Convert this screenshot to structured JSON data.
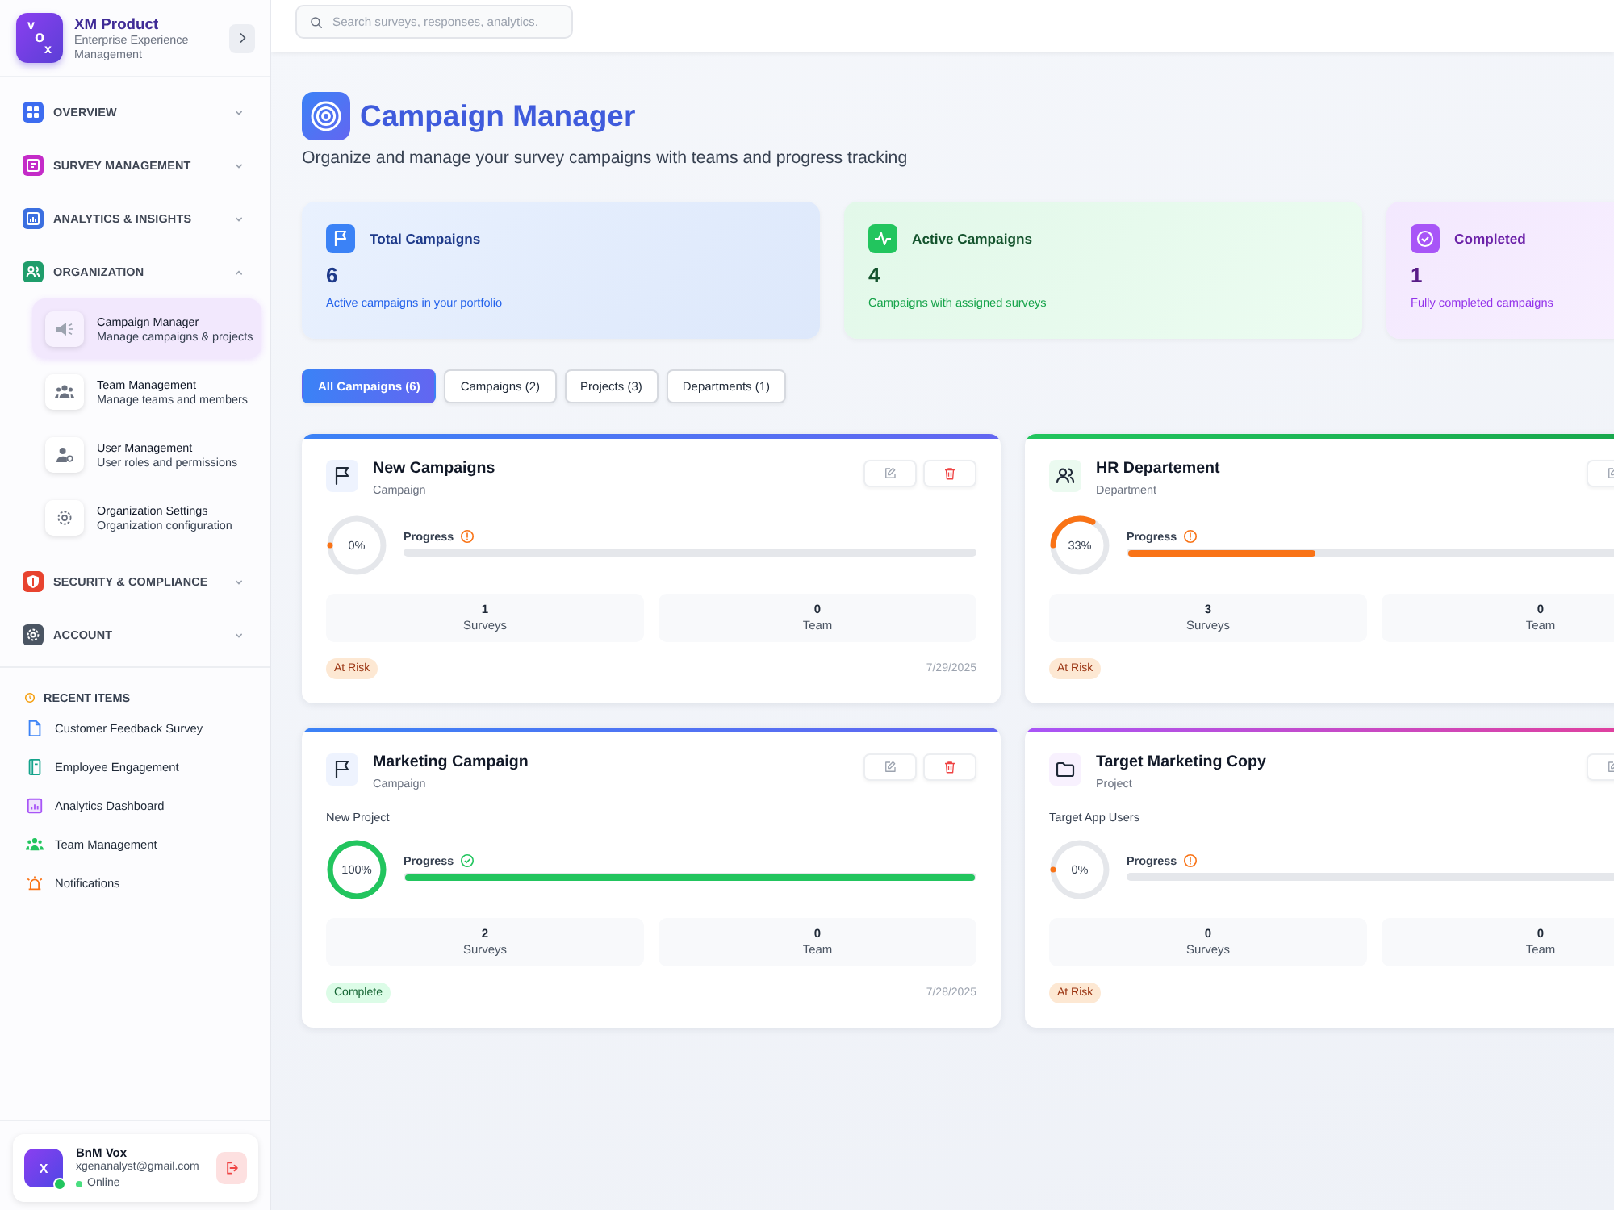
{
  "sidebar": {
    "brand": {
      "logo_letters": [
        "v",
        "o",
        "x"
      ],
      "title": "XM Product",
      "subtitle": "Enterprise Experience Management"
    },
    "nav": [
      {
        "kind": "overview",
        "label": "OVERVIEW",
        "expanded": false
      },
      {
        "kind": "surveys",
        "label": "SURVEY MANAGEMENT",
        "expanded": false
      },
      {
        "kind": "analytics",
        "label": "ANALYTICS & INSIGHTS",
        "expanded": false
      },
      {
        "kind": "organization",
        "label": "ORGANIZATION",
        "expanded": true,
        "children": [
          {
            "kind": "campaigns",
            "title": "Campaign Manager",
            "subtitle": "Manage campaigns & projects",
            "selected": true
          },
          {
            "kind": "teams",
            "title": "Team Management",
            "subtitle": "Manage teams and members",
            "selected": false
          },
          {
            "kind": "users",
            "title": "User Management",
            "subtitle": "User roles and permissions",
            "selected": false
          },
          {
            "kind": "settings",
            "title": "Organization Settings",
            "subtitle": "Organization configuration",
            "selected": false
          }
        ]
      },
      {
        "kind": "security",
        "label": "SECURITY & COMPLIANCE",
        "expanded": false
      },
      {
        "kind": "account",
        "label": "ACCOUNT",
        "expanded": false
      }
    ],
    "recent": {
      "title": "RECENT ITEMS",
      "items": [
        {
          "kind": "survey",
          "label": "Customer Feedback Survey"
        },
        {
          "kind": "engagement",
          "label": "Employee Engagement"
        },
        {
          "kind": "dashboard",
          "label": "Analytics Dashboard"
        },
        {
          "kind": "team",
          "label": "Team Management"
        },
        {
          "kind": "notifications",
          "label": "Notifications"
        }
      ]
    },
    "user": {
      "avatar_letter": "X",
      "name": "BnM Vox",
      "email": "xgenanalyst@gmail.com",
      "status": "Online",
      "online": true
    }
  },
  "header": {
    "search": {
      "placeholder": "Search surveys, responses, analytics."
    }
  },
  "page": {
    "title": "Campaign Manager",
    "subtitle": "Organize and manage your survey campaigns with teams and progress tracking"
  },
  "stats": [
    {
      "kind": "total",
      "label": "Total Campaigns",
      "value": "6",
      "description": "Active campaigns in your portfolio"
    },
    {
      "kind": "active",
      "label": "Active Campaigns",
      "value": "4",
      "description": "Campaigns with assigned surveys"
    },
    {
      "kind": "completed",
      "label": "Completed",
      "value": "1",
      "description": "Fully completed campaigns"
    }
  ],
  "filters": [
    {
      "label": "All Campaigns (6)",
      "selected": true
    },
    {
      "label": "Campaigns (2)",
      "selected": false
    },
    {
      "label": "Projects (3)",
      "selected": false
    },
    {
      "label": "Departments (1)",
      "selected": false
    }
  ],
  "cards": [
    {
      "kind": "campaign",
      "title": "New Campaigns",
      "type": "Campaign",
      "actions": [
        {
          "kind": "edit"
        },
        {
          "kind": "delete"
        }
      ],
      "progress": {
        "label": "Progress",
        "reading": "0%",
        "level": 0
      },
      "stats": [
        {
          "value": "1",
          "label": "Surveys"
        },
        {
          "value": "0",
          "label": "Team"
        }
      ],
      "status": {
        "kind": "at_risk",
        "label": "At Risk"
      },
      "date": "7/29/2025"
    },
    {
      "kind": "department",
      "title": "HR Departement",
      "type": "Department",
      "actions": [
        {
          "kind": "edit"
        }
      ],
      "progress": {
        "label": "Progress",
        "reading": "33%",
        "level": 0.33
      },
      "stats": [
        {
          "value": "3",
          "label": "Surveys"
        },
        {
          "value": "0",
          "label": "Team"
        }
      ],
      "status": {
        "kind": "at_risk",
        "label": "At Risk"
      }
    },
    {
      "kind": "campaign",
      "title": "Marketing Campaign",
      "type": "Campaign",
      "actions": [
        {
          "kind": "edit"
        },
        {
          "kind": "delete"
        }
      ],
      "description": "New Project",
      "progress": {
        "label": "Progress",
        "reading": "100%",
        "level": 1
      },
      "stats": [
        {
          "value": "2",
          "label": "Surveys"
        },
        {
          "value": "0",
          "label": "Team"
        }
      ],
      "status": {
        "kind": "complete",
        "label": "Complete"
      },
      "date": "7/28/2025"
    },
    {
      "kind": "project",
      "title": "Target Marketing Copy",
      "type": "Project",
      "actions": [
        {
          "kind": "edit"
        }
      ],
      "description": "Target App Users",
      "progress": {
        "label": "Progress",
        "reading": "0%",
        "level": 0
      },
      "stats": [
        {
          "value": "0",
          "label": "Surveys"
        },
        {
          "value": "0",
          "label": "Team"
        }
      ],
      "status": {
        "kind": "at_risk",
        "label": "At Risk"
      }
    }
  ]
}
